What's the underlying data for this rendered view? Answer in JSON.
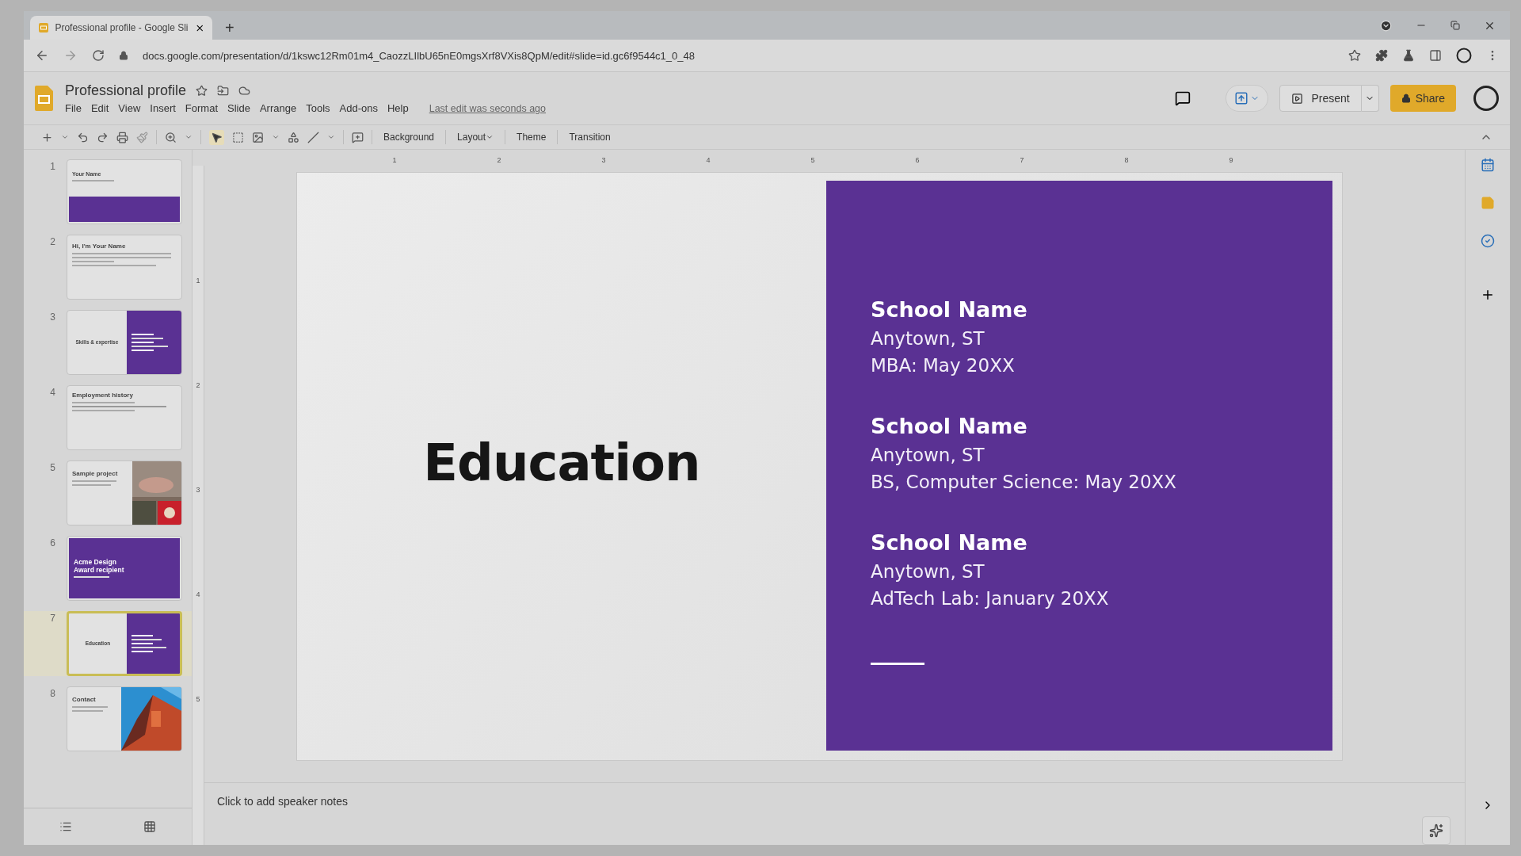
{
  "browser": {
    "tab_title": "Professional profile - Google Sli",
    "new_tab": "+",
    "url": "docs.google.com/presentation/d/1kswc12Rm01m4_CaozzLIlbU65nE0mgsXrf8VXis8QpM/edit#slide=id.gc6f9544c1_0_48"
  },
  "doc": {
    "title": "Professional profile",
    "menus": [
      "File",
      "Edit",
      "View",
      "Insert",
      "Format",
      "Slide",
      "Arrange",
      "Tools",
      "Add-ons",
      "Help"
    ],
    "last_edit": "Last edit was seconds ago"
  },
  "header": {
    "present": "Present",
    "share": "Share"
  },
  "toolbar": {
    "buttons": [
      {
        "label": "Background",
        "dropdown": false
      },
      {
        "label": "Layout",
        "dropdown": true
      },
      {
        "label": "Theme",
        "dropdown": false
      },
      {
        "label": "Transition",
        "dropdown": false
      }
    ]
  },
  "ruler": {
    "horizontal": [
      "1",
      "2",
      "3",
      "4",
      "5",
      "6",
      "7",
      "8",
      "9"
    ],
    "vertical": [
      "1",
      "2",
      "3",
      "4",
      "5"
    ]
  },
  "thumbnails": [
    {
      "number": "1",
      "kind": "title",
      "title": "Your Name",
      "selected": false
    },
    {
      "number": "2",
      "kind": "text",
      "title": "Hi, I'm Your Name",
      "selected": false
    },
    {
      "number": "3",
      "kind": "split",
      "title": "Skills & expertise",
      "selected": false
    },
    {
      "number": "4",
      "kind": "timeline",
      "title": "Employment history",
      "selected": false
    },
    {
      "number": "5",
      "title": "Sample project",
      "selected": false
    },
    {
      "number": "6",
      "kind": "purple",
      "title": "Acme Design Award recipient",
      "selected": false
    },
    {
      "number": "7",
      "kind": "split",
      "title": "Education",
      "selected": true
    },
    {
      "number": "8",
      "title": "Contact",
      "selected": false
    }
  ],
  "slide": {
    "title": "Education",
    "entries": [
      {
        "school": "School Name",
        "location": "Anytown, ST",
        "degree": "MBA: May 20XX"
      },
      {
        "school": "School Name",
        "location": "Anytown, ST",
        "degree": "BS, Computer Science: May 20XX"
      },
      {
        "school": "School Name",
        "location": "Anytown, ST",
        "degree": "AdTech Lab: January 20XX"
      }
    ]
  },
  "notes": {
    "placeholder": "Click to add speaker notes"
  }
}
